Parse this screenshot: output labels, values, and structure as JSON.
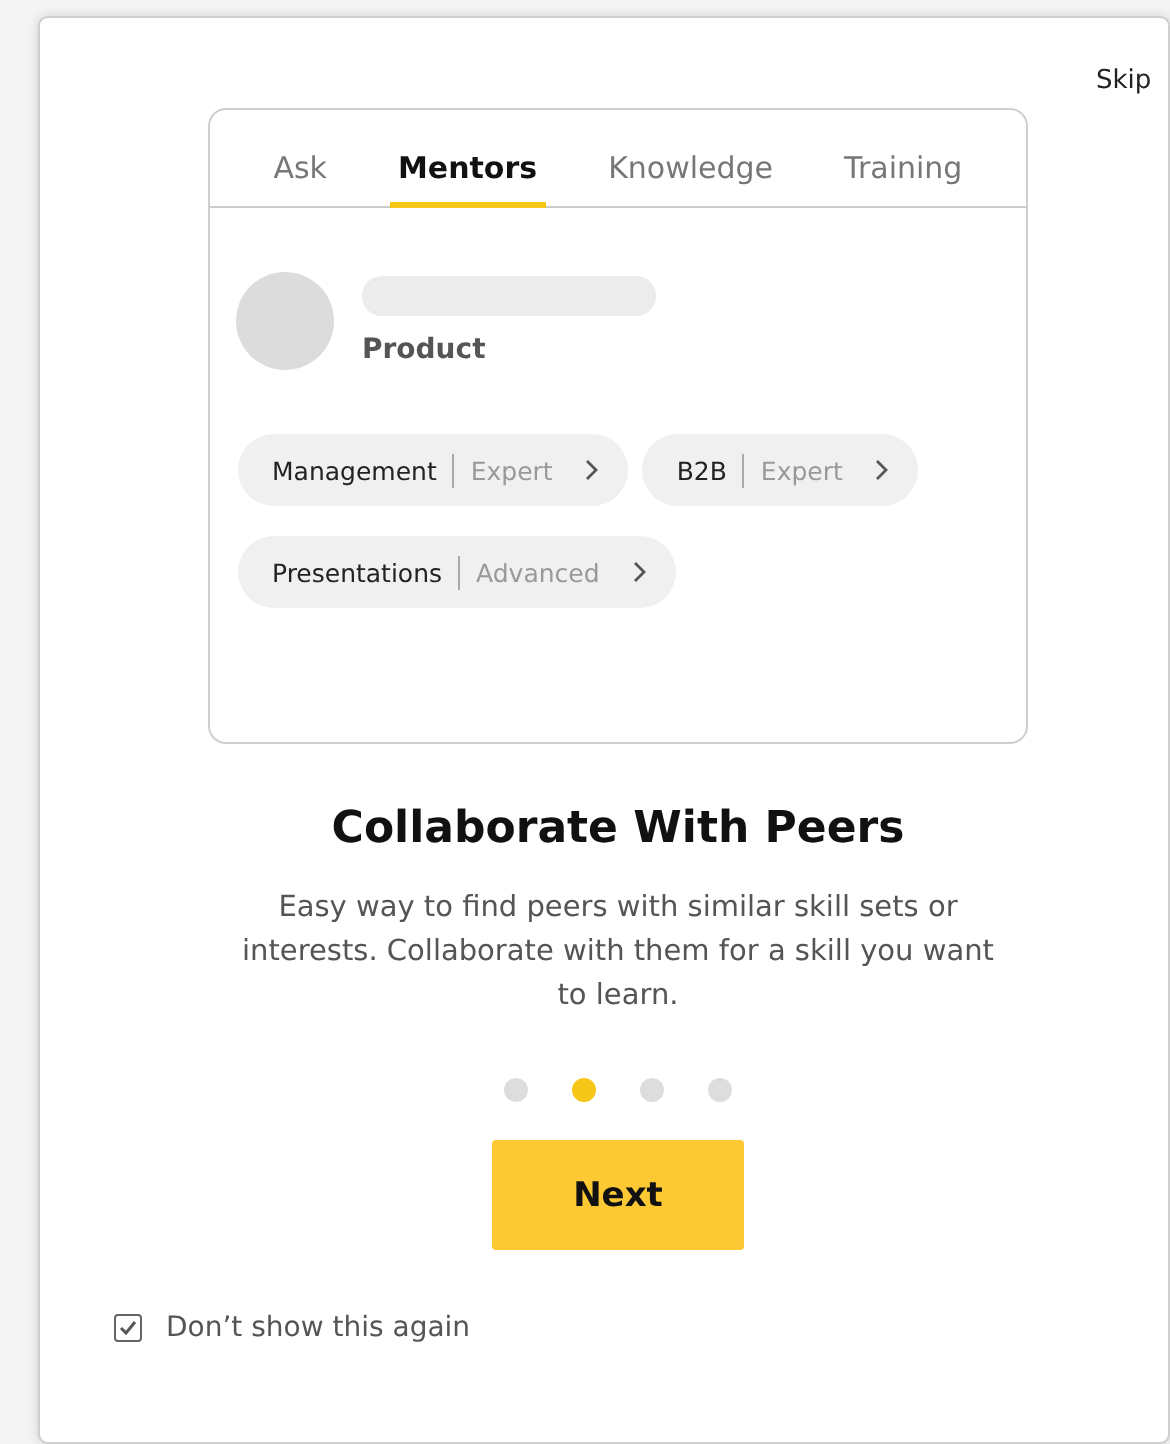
{
  "skip": "Skip",
  "tabs": [
    {
      "label": "Ask",
      "selected": false
    },
    {
      "label": "Mentors",
      "selected": true
    },
    {
      "label": "Knowledge",
      "selected": false
    },
    {
      "label": "Training",
      "selected": false
    }
  ],
  "profile": {
    "role": "Product"
  },
  "skills": [
    {
      "name": "Management",
      "level": "Expert"
    },
    {
      "name": "B2B",
      "level": "Expert"
    },
    {
      "name": "Presentations",
      "level": "Advanced"
    }
  ],
  "title": "Collaborate With Peers",
  "description": "Easy way to find peers with similar skill sets or interests. Collaborate with them for a skill you want to learn.",
  "pages": [
    {
      "selected": false
    },
    {
      "selected": true
    },
    {
      "selected": false
    },
    {
      "selected": false
    }
  ],
  "next_button": "Next",
  "dont_show": {
    "label": "Don’t show this again",
    "checked": true
  }
}
